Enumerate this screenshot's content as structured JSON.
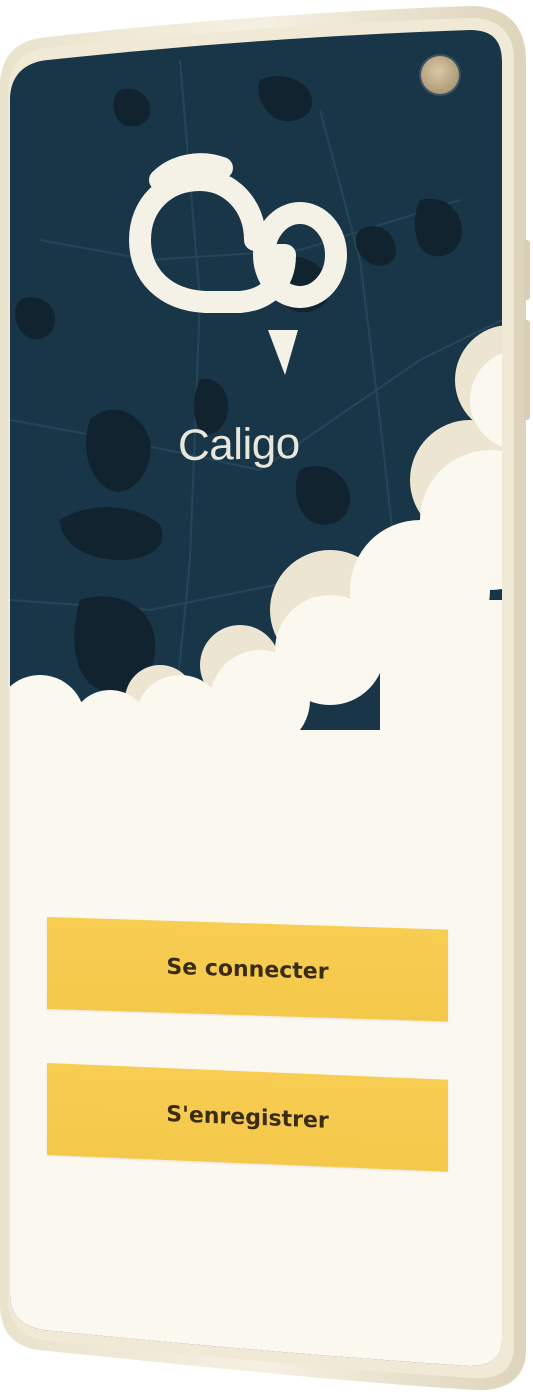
{
  "app": {
    "name": "Caligo"
  },
  "actions": {
    "login_label": "Se connecter",
    "register_label": "S'enregistrer"
  },
  "colors": {
    "map_background": "#193548",
    "water": "#102431",
    "cloud": "#fbf8f0",
    "cloud_shadow": "#ebe5d1",
    "button": "#f5c94c",
    "button_text": "#3a2b14",
    "logo": "#f4f1e7"
  },
  "icons": {
    "logo": "caligo-logo-icon",
    "camera": "front-camera-icon"
  }
}
